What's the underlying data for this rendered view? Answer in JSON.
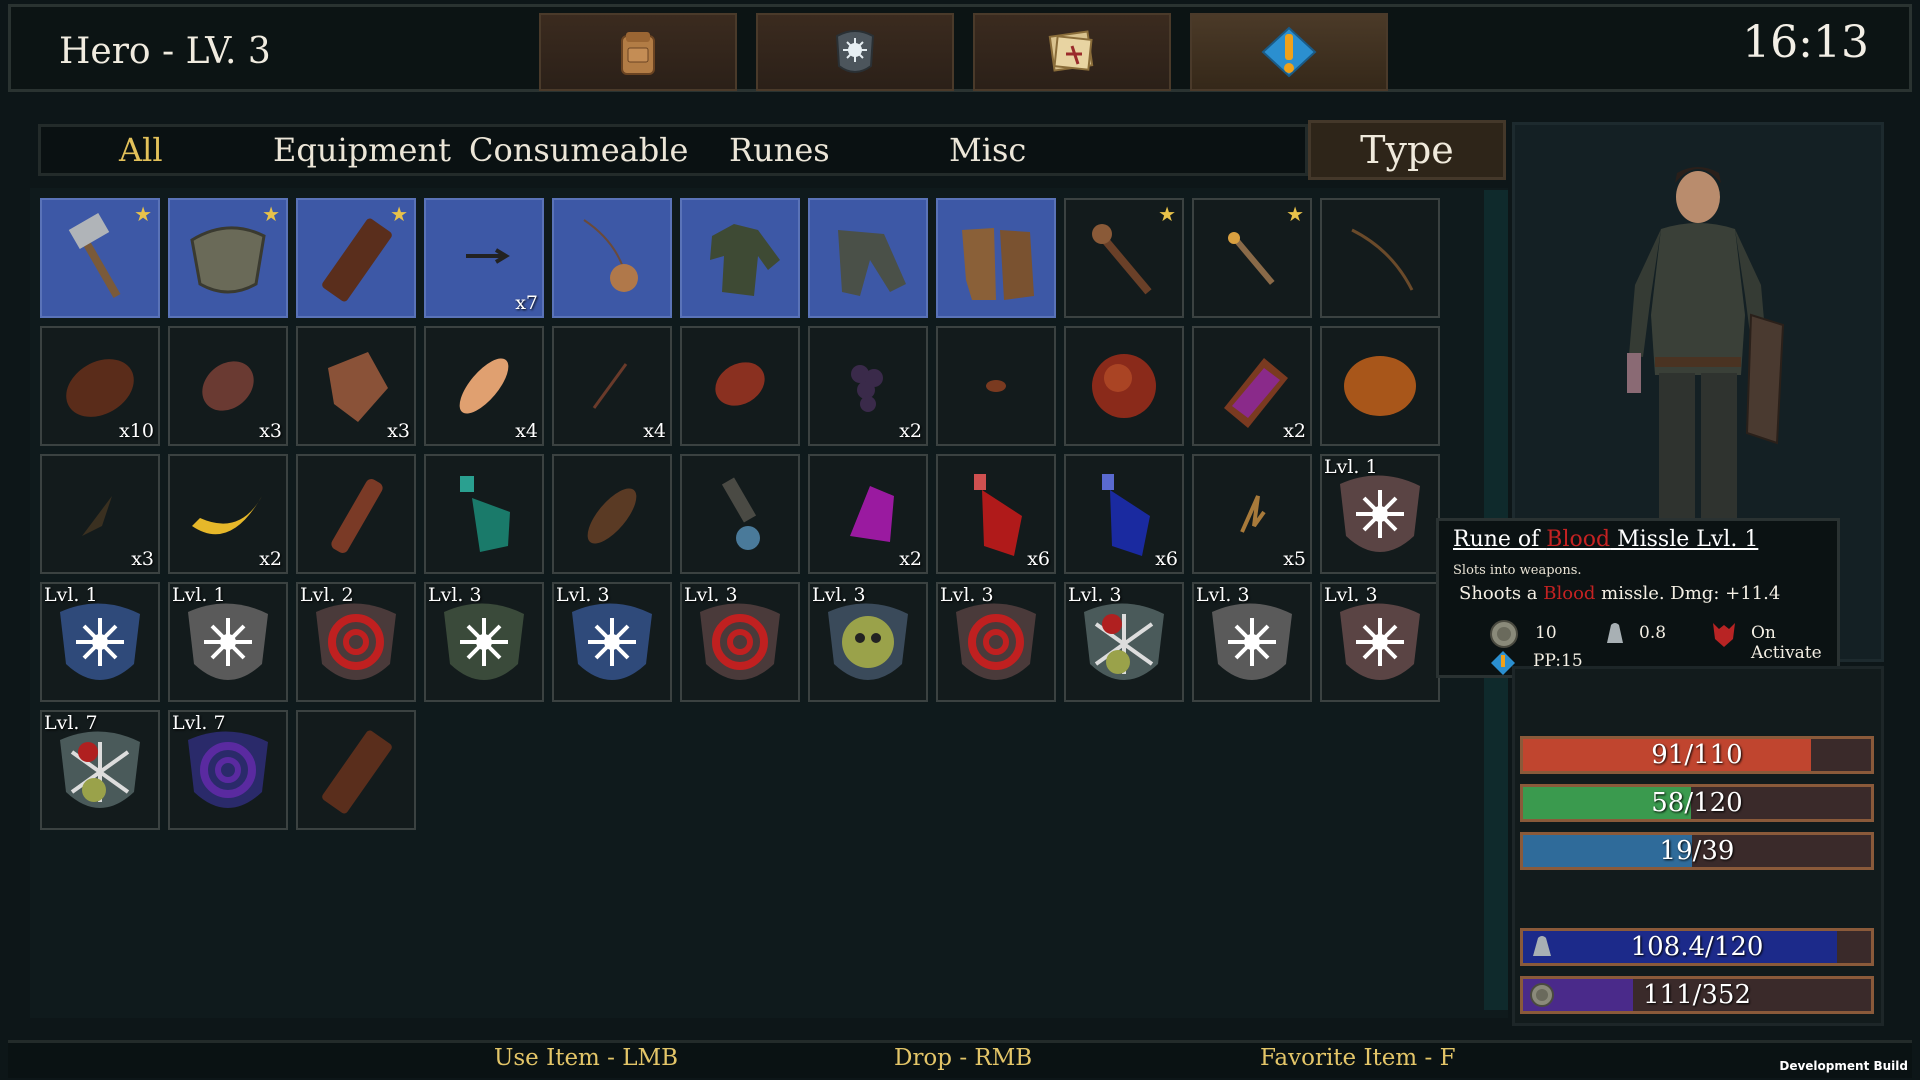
{
  "header": {
    "title": "Hero - LV. 3",
    "clock": "16:13",
    "tabs": [
      {
        "icon": "backpack-icon"
      },
      {
        "icon": "rune-stone-icon"
      },
      {
        "icon": "map-scroll-icon"
      },
      {
        "icon": "quest-alert-icon"
      }
    ]
  },
  "categories": [
    "All",
    "Equipment",
    "Consumeable",
    "Runes",
    "Misc"
  ],
  "active_category": "All",
  "type_button": "Type",
  "inventory": {
    "rows": [
      [
        {
          "icon": "hammer-icon",
          "equipped": true,
          "favorite": true,
          "qty": "",
          "lvl": ""
        },
        {
          "icon": "shield-icon",
          "equipped": true,
          "favorite": true,
          "qty": "",
          "lvl": ""
        },
        {
          "icon": "wooden-plank-icon",
          "equipped": true,
          "favorite": true,
          "qty": "",
          "lvl": ""
        },
        {
          "icon": "arrow-icon",
          "equipped": true,
          "favorite": false,
          "qty": "x7",
          "lvl": ""
        },
        {
          "icon": "amulet-icon",
          "equipped": true,
          "favorite": false,
          "qty": "",
          "lvl": ""
        },
        {
          "icon": "shirt-icon",
          "equipped": true,
          "favorite": false,
          "qty": "",
          "lvl": ""
        },
        {
          "icon": "pants-icon",
          "equipped": true,
          "favorite": false,
          "qty": "",
          "lvl": ""
        },
        {
          "icon": "boots-icon",
          "equipped": true,
          "favorite": false,
          "qty": "",
          "lvl": ""
        },
        {
          "icon": "club-icon",
          "equipped": false,
          "favorite": true,
          "qty": "",
          "lvl": ""
        },
        {
          "icon": "torch-icon",
          "equipped": false,
          "favorite": true,
          "qty": "",
          "lvl": ""
        },
        {
          "icon": "bow-icon",
          "equipped": false,
          "favorite": false,
          "qty": "",
          "lvl": ""
        }
      ],
      [
        {
          "icon": "bread-icon",
          "equipped": false,
          "favorite": false,
          "qty": "x10",
          "lvl": ""
        },
        {
          "icon": "meat-icon",
          "equipped": false,
          "favorite": false,
          "qty": "x3",
          "lvl": ""
        },
        {
          "icon": "leather-icon",
          "equipped": false,
          "favorite": false,
          "qty": "x3",
          "lvl": ""
        },
        {
          "icon": "fish-icon",
          "equipped": false,
          "favorite": false,
          "qty": "x4",
          "lvl": ""
        },
        {
          "icon": "stick-icon",
          "equipped": false,
          "favorite": false,
          "qty": "x4",
          "lvl": ""
        },
        {
          "icon": "raw-meat-icon",
          "equipped": false,
          "favorite": false,
          "qty": "",
          "lvl": ""
        },
        {
          "icon": "grapes-icon",
          "equipped": false,
          "favorite": false,
          "qty": "x2",
          "lvl": ""
        },
        {
          "icon": "seed-icon",
          "equipped": false,
          "favorite": false,
          "qty": "",
          "lvl": ""
        },
        {
          "icon": "apple-icon",
          "equipped": false,
          "favorite": false,
          "qty": "",
          "lvl": ""
        },
        {
          "icon": "book-icon",
          "equipped": false,
          "favorite": false,
          "qty": "x2",
          "lvl": ""
        },
        {
          "icon": "orange-icon",
          "equipped": false,
          "favorite": false,
          "qty": "",
          "lvl": ""
        }
      ],
      [
        {
          "icon": "feather-icon",
          "equipped": false,
          "favorite": false,
          "qty": "x3",
          "lvl": ""
        },
        {
          "icon": "banana-icon",
          "equipped": false,
          "favorite": false,
          "qty": "x2",
          "lvl": ""
        },
        {
          "icon": "belt-icon",
          "equipped": false,
          "favorite": false,
          "qty": "",
          "lvl": ""
        },
        {
          "icon": "green-potion-icon",
          "equipped": false,
          "favorite": false,
          "qty": "",
          "lvl": ""
        },
        {
          "icon": "bowl-icon",
          "equipped": false,
          "favorite": false,
          "qty": "",
          "lvl": ""
        },
        {
          "icon": "lantern-icon",
          "equipped": false,
          "favorite": false,
          "qty": "",
          "lvl": ""
        },
        {
          "icon": "purple-gem-icon",
          "equipped": false,
          "favorite": false,
          "qty": "x2",
          "lvl": ""
        },
        {
          "icon": "red-potion-icon",
          "equipped": false,
          "favorite": false,
          "qty": "x6",
          "lvl": ""
        },
        {
          "icon": "blue-potion-icon",
          "equipped": false,
          "favorite": false,
          "qty": "x6",
          "lvl": ""
        },
        {
          "icon": "twig-icon",
          "equipped": false,
          "favorite": false,
          "qty": "x5",
          "lvl": ""
        },
        {
          "icon": "rune-brown-star-icon",
          "equipped": false,
          "favorite": false,
          "qty": "",
          "lvl": "Lvl. 1"
        }
      ],
      [
        {
          "icon": "rune-blue-star-icon",
          "equipped": false,
          "favorite": false,
          "qty": "",
          "lvl": "Lvl. 1"
        },
        {
          "icon": "rune-grey-star-icon",
          "equipped": false,
          "favorite": false,
          "qty": "",
          "lvl": "Lvl. 1"
        },
        {
          "icon": "rune-red-swirl-icon",
          "equipped": false,
          "favorite": false,
          "qty": "",
          "lvl": "Lvl. 2"
        },
        {
          "icon": "rune-green-star-icon",
          "equipped": false,
          "favorite": false,
          "qty": "",
          "lvl": "Lvl. 3"
        },
        {
          "icon": "rune-blue-star-icon",
          "equipped": false,
          "favorite": false,
          "qty": "",
          "lvl": "Lvl. 3"
        },
        {
          "icon": "rune-red-swirl-icon",
          "equipped": false,
          "favorite": false,
          "qty": "",
          "lvl": "Lvl. 3"
        },
        {
          "icon": "rune-skull-icon",
          "equipped": false,
          "favorite": false,
          "qty": "",
          "lvl": "Lvl. 3"
        },
        {
          "icon": "rune-red-swirl-icon",
          "equipped": false,
          "favorite": false,
          "qty": "",
          "lvl": "Lvl. 3"
        },
        {
          "icon": "rune-mixed-icon",
          "equipped": false,
          "favorite": false,
          "qty": "",
          "lvl": "Lvl. 3"
        },
        {
          "icon": "rune-grey-star-icon",
          "equipped": false,
          "favorite": false,
          "qty": "",
          "lvl": "Lvl. 3"
        },
        {
          "icon": "rune-brown-star-icon",
          "equipped": false,
          "favorite": false,
          "qty": "",
          "lvl": "Lvl. 3"
        }
      ],
      [
        {
          "icon": "rune-mixed-icon",
          "equipped": false,
          "favorite": false,
          "qty": "",
          "lvl": "Lvl. 7"
        },
        {
          "icon": "rune-purple-swirl-icon",
          "equipped": false,
          "favorite": false,
          "qty": "",
          "lvl": "Lvl. 7"
        },
        {
          "icon": "wooden-plank-icon",
          "equipped": false,
          "favorite": false,
          "qty": "",
          "lvl": ""
        }
      ]
    ]
  },
  "tooltip": {
    "title_pre": "Rune of ",
    "title_red": "Blood",
    "title_post": " Missle Lvl. 1",
    "desc": "Slots into weapons.",
    "effect_pre": "Shoots a ",
    "effect_red": "Blood",
    "effect_post": " missle. Dmg: +11.4",
    "value": "10",
    "weight": "0.8",
    "trigger": "On Activate",
    "pp": "PP:15"
  },
  "stats": {
    "health": {
      "text": "91/110",
      "fraction": 0.827,
      "color": "#c0452f"
    },
    "stamina": {
      "text": "58/120",
      "fraction": 0.483,
      "color": "#3a9a4e"
    },
    "mana": {
      "text": "19/39",
      "fraction": 0.487,
      "color": "#2f6b9a"
    },
    "weight": {
      "text": "108.4/120",
      "fraction": 0.903,
      "color": "#1c2a8a"
    },
    "xp": {
      "text": "111/352",
      "fraction": 0.315,
      "color": "#4a2a8a"
    }
  },
  "hints": {
    "use": "Use Item - LMB",
    "drop": "Drop -  RMB",
    "favorite": "Favorite Item - F"
  },
  "build_label": "Development Build",
  "colors": {
    "accent_gold": "#e3c568",
    "blood_red": "#c42222",
    "equipped_slot": "#3d58a6"
  }
}
